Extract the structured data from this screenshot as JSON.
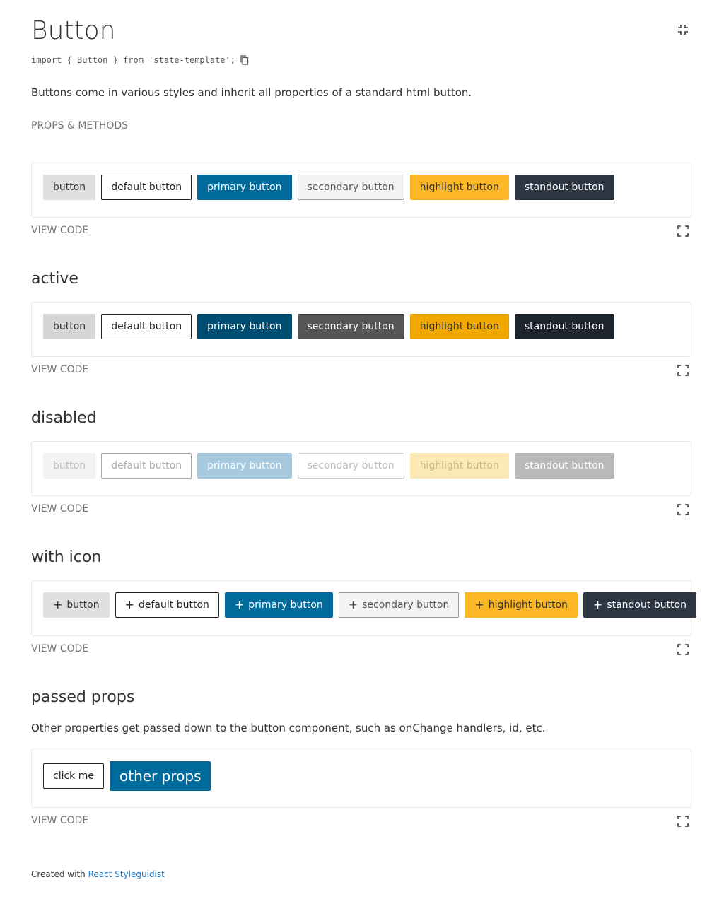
{
  "header": {
    "title": "Button",
    "import_statement": "import { Button } from 'state-template';",
    "description": "Buttons come in various styles and inherit all properties of a standard html button.",
    "props_link": "PROPS & METHODS"
  },
  "view_code_label": "VIEW CODE",
  "buttons": {
    "plain": "button",
    "default": "default button",
    "primary": "primary button",
    "secondary": "secondary button",
    "highlight": "highlight button",
    "standout": "standout button"
  },
  "sections": {
    "active": {
      "title": "active"
    },
    "disabled": {
      "title": "disabled"
    },
    "with_icon": {
      "title": "with icon",
      "icon": "plus-icon"
    },
    "passed_props": {
      "title": "passed props",
      "description": "Other properties get passed down to the button component, such as onChange handlers, id, etc.",
      "click_me": "click me",
      "other_props": "other props"
    }
  },
  "footer": {
    "prefix": "Created with",
    "link": "React Styleguidist"
  },
  "colors": {
    "primary": "#006a9b",
    "highlight": "#fbb725",
    "standout": "#2d3542",
    "link": "#1978c8"
  }
}
